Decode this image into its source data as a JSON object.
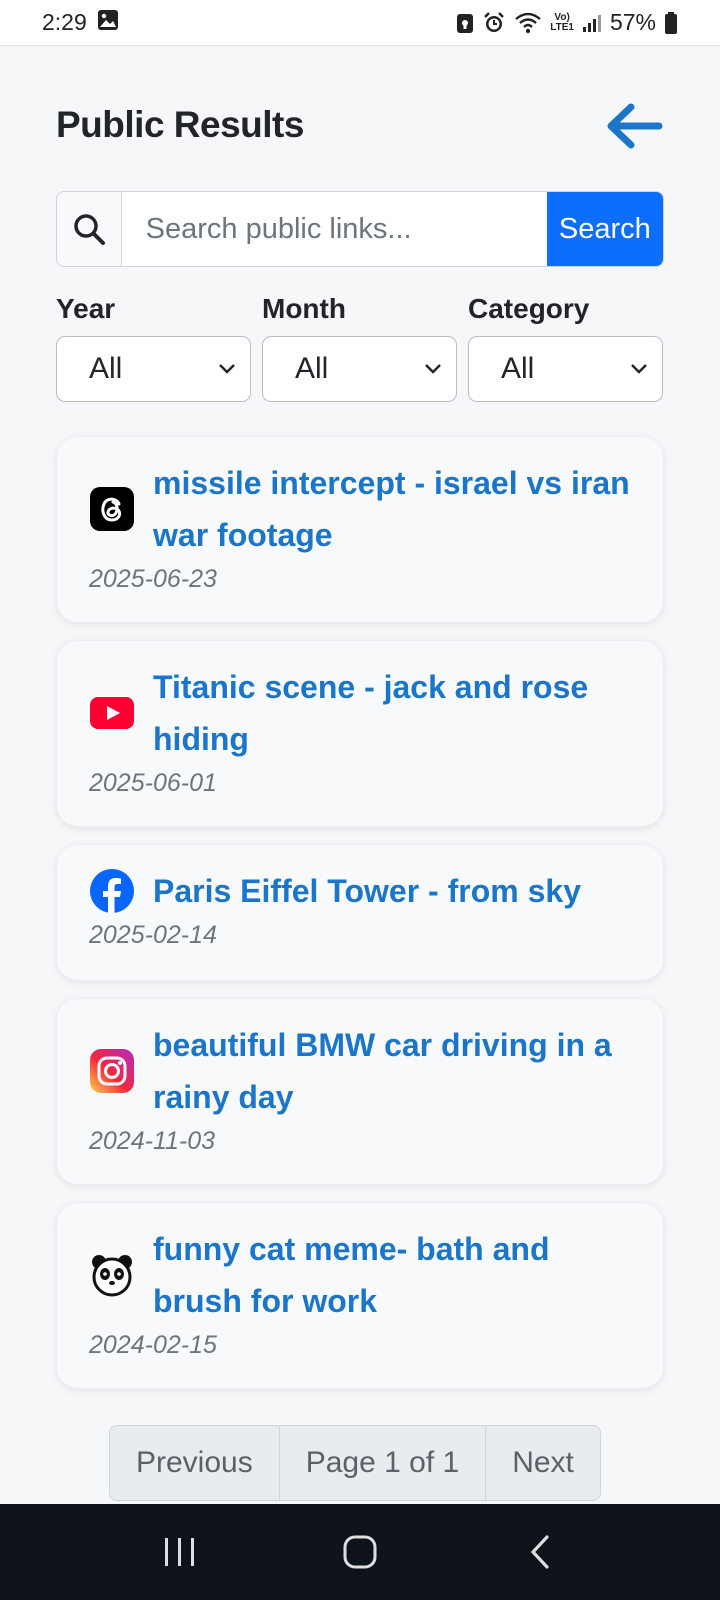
{
  "status_bar": {
    "time": "2:29",
    "battery": "57%",
    "network_label_top": "Vo)",
    "network_label_bottom": "LTE1"
  },
  "header": {
    "title": "Public Results",
    "back_icon": "arrow-left-icon"
  },
  "search": {
    "placeholder": "Search public links...",
    "button_label": "Search"
  },
  "filters": [
    {
      "label": "Year",
      "value": "All"
    },
    {
      "label": "Month",
      "value": "All"
    },
    {
      "label": "Category",
      "value": "All"
    }
  ],
  "results": [
    {
      "platform": "threads",
      "title": "missile intercept - israel vs iran war footage",
      "date": "2025-06-23"
    },
    {
      "platform": "youtube",
      "title": "Titanic scene - jack and rose hiding",
      "date": "2025-06-01"
    },
    {
      "platform": "facebook",
      "title": "Paris Eiffel Tower - from sky",
      "date": "2025-02-14"
    },
    {
      "platform": "instagram",
      "title": "beautiful BMW car driving in a rainy day",
      "date": "2024-11-03"
    },
    {
      "platform": "panda",
      "title": "funny cat meme- bath and brush for work",
      "date": "2024-02-15"
    }
  ],
  "pagination": {
    "previous": "Previous",
    "page": "Page 1 of 1",
    "next": "Next"
  },
  "colors": {
    "accent": "#0d6efd",
    "link": "#1b75c9",
    "date": "#6c757d"
  }
}
